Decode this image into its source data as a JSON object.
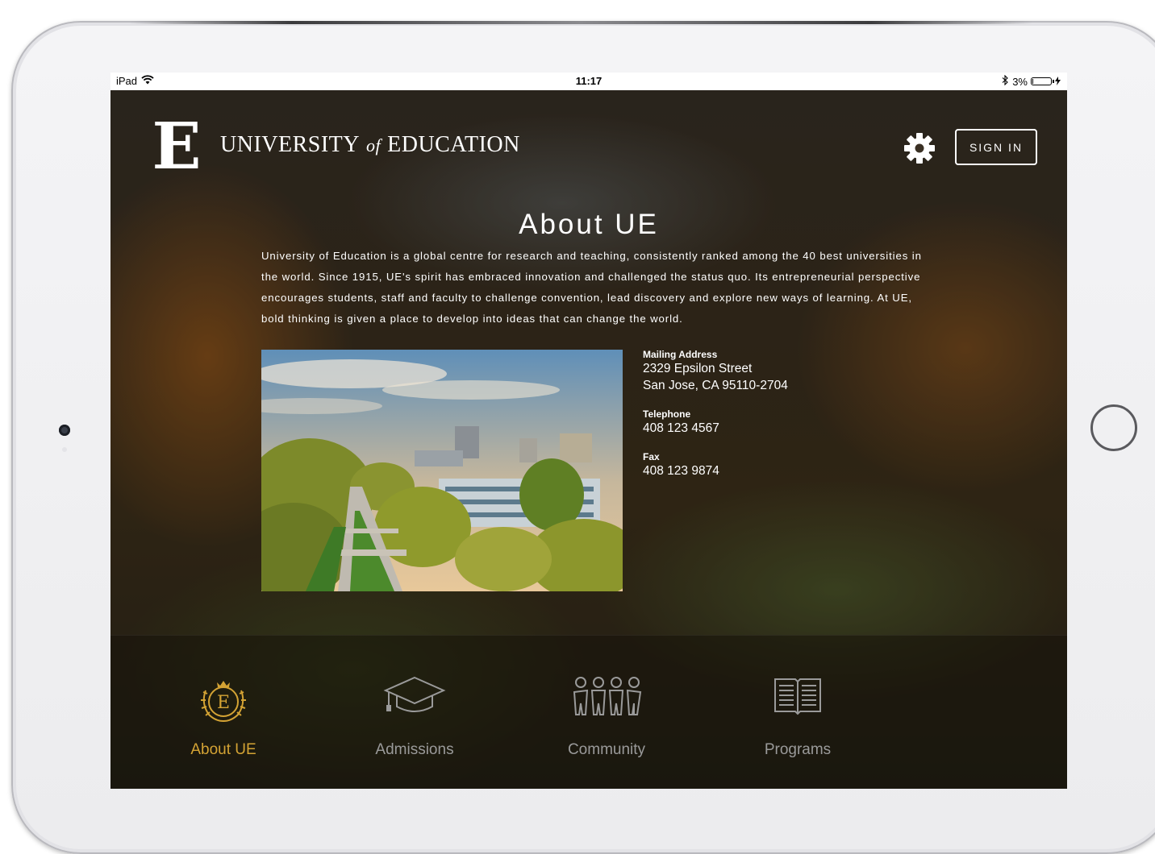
{
  "status_bar": {
    "device": "iPad",
    "time": "11:17",
    "battery": "3%",
    "battery_level": 0.03
  },
  "header": {
    "logo_letter": "E",
    "logo_name_part1": "UNIVERSITY",
    "logo_name_of": "of",
    "logo_name_part2": "EDUCATION",
    "signin_label": "SIGN IN"
  },
  "page": {
    "title": "About UE",
    "intro": "University of Education is a global centre for research and teaching, consistently ranked among the 40 best universities in the world. Since 1915, UE's spirit has embraced innovation and challenged the status quo. Its entrepreneurial perspective encourages students, staff and faculty to challenge convention, lead discovery and explore new ways of learning. At UE, bold thinking is given a place to develop into ideas that can change the world."
  },
  "contact": {
    "mailing_label": "Mailing Address",
    "mailing_line1": "2329 Epsilon Street",
    "mailing_line2": "San Jose, CA 95110-2704",
    "telephone_label": "Telephone",
    "telephone": "408 123 4567",
    "fax_label": "Fax",
    "fax": "408 123 9874"
  },
  "nav": {
    "active_color": "#d4a334",
    "inactive_color": "#9a9a9a",
    "items": [
      {
        "label": "About UE",
        "icon": "crest-icon",
        "active": true
      },
      {
        "label": "Admissions",
        "icon": "graduation-cap-icon",
        "active": false
      },
      {
        "label": "Community",
        "icon": "community-icon",
        "active": false
      },
      {
        "label": "Programs",
        "icon": "book-icon",
        "active": false
      }
    ]
  }
}
